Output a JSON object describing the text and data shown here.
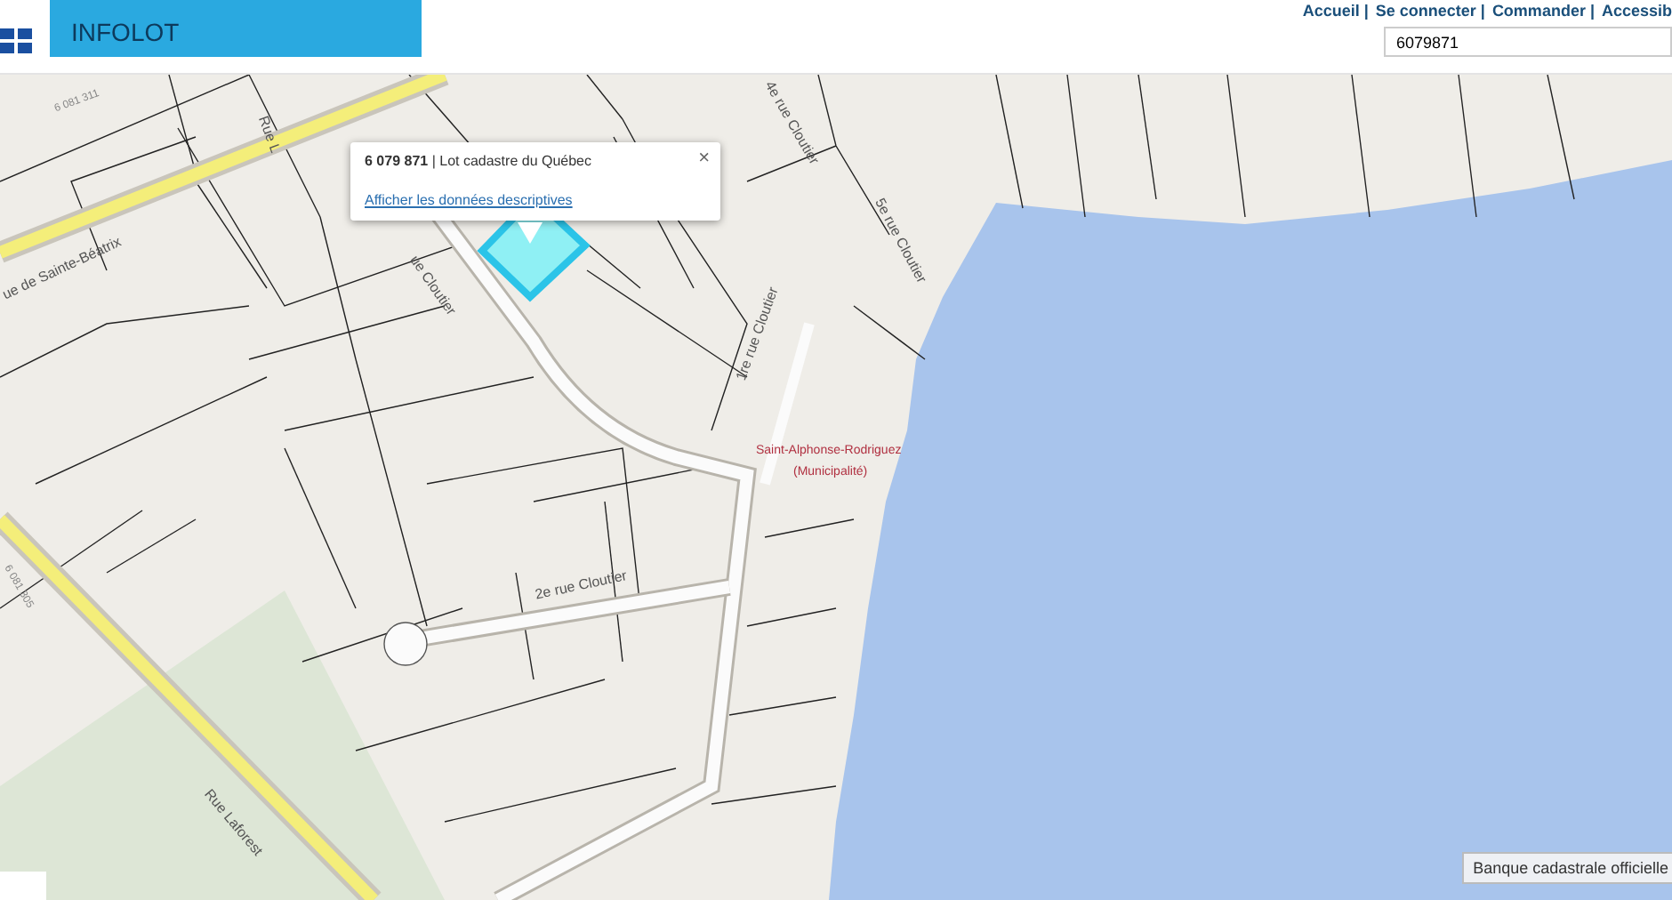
{
  "header": {
    "title": "INFOLOT",
    "links": [
      "Accueil |",
      "Se connecter |",
      "Commander |",
      "Accessib"
    ],
    "search": {
      "value": "6079871"
    }
  },
  "map": {
    "labels": [
      {
        "text": "6 081 311",
        "kind": "lot"
      },
      {
        "text": "ue de Sainte-Béatrix",
        "kind": "street"
      },
      {
        "text": "Rue L",
        "kind": "street"
      },
      {
        "text": "ue Cloutier",
        "kind": "street"
      },
      {
        "text": "4e rue Cloutier",
        "kind": "street"
      },
      {
        "text": "5e rue Cloutier",
        "kind": "street"
      },
      {
        "text": "1re rue Cloutier",
        "kind": "street"
      },
      {
        "text": "Saint-Alphonse-Rodriguez",
        "kind": "place"
      },
      {
        "text": "(Municipalité)",
        "kind": "place"
      },
      {
        "text": "2e rue Cloutier",
        "kind": "street"
      },
      {
        "text": "6 081 305",
        "kind": "lot"
      },
      {
        "text": "Rue Laforest",
        "kind": "street"
      }
    ],
    "popup": {
      "title": "**6 079 871** | Lot cadastre du Québec",
      "link": "Afficher les données descriptives",
      "close": "×"
    },
    "attribution": "Banque cadastrale officielle"
  }
}
